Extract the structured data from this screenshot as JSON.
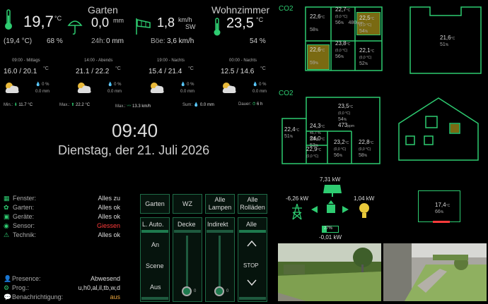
{
  "weather": {
    "garden": {
      "title": "Garten"
    },
    "wohnzimmer": {
      "title": "Wohnzimmer"
    },
    "outdoor_temp": "19,7",
    "outdoor_temp_unit": "°C",
    "outdoor_feels": "(19,4 °C)",
    "outdoor_humidity": "68 %",
    "rain_now": "0,0",
    "rain_unit": "mm",
    "rain_24h_label": "24h:",
    "rain_24h": "0 mm",
    "wind_speed": "1,8",
    "wind_unit": "km/h",
    "wind_dir": "SW",
    "gust_label": "Böe:",
    "gust": "3,6 km/h",
    "indoor_temp": "23,5",
    "indoor_temp_unit": "°C",
    "indoor_humidity": "54 %"
  },
  "forecast": [
    {
      "time": "09:00 - Mittags",
      "temp": "16.0 / 20.1",
      "unit": "°C",
      "rain_pct": "0 %",
      "rain_mm": "0.0 mm"
    },
    {
      "time": "14:00 - Abends",
      "temp": "21.1 / 22.2",
      "unit": "°C",
      "rain_pct": "0 %",
      "rain_mm": "0.0 mm"
    },
    {
      "time": "19:00 - Nachts",
      "temp": "15.4 / 21.4",
      "unit": "°C",
      "rain_pct": "0 %",
      "rain_mm": "0.0 mm"
    },
    {
      "time": "00:00 - Nachts",
      "temp": "12.5 / 14.6",
      "unit": "°C",
      "rain_pct": "0 %",
      "rain_mm": "0.0 mm"
    }
  ],
  "summary": {
    "min_label": "Min.:",
    "min": "11.7 °C",
    "max_label": "Max.:",
    "max": "22.2 °C",
    "wind_max_label": "Max.:",
    "wind_max": "13.3 km/h",
    "sum_label": "Sum:",
    "sum": "0.0 mm",
    "duration_label": "Dauer:",
    "duration": "6 h"
  },
  "clock": {
    "time": "09:40",
    "date": "Dienstag, der 21. Juli 2026"
  },
  "status": [
    {
      "label": "Fenster:",
      "value": "Alles zu",
      "color": "#dddddd"
    },
    {
      "label": "Garten:",
      "value": "Alles ok",
      "color": "#dddddd"
    },
    {
      "label": "Geräte:",
      "value": "Alles ok",
      "color": "#dddddd"
    },
    {
      "label": "Sensor:",
      "value": "Giessen",
      "color": "#ff3b3b"
    },
    {
      "label": "Technik:",
      "value": "Alles ok",
      "color": "#dddddd"
    }
  ],
  "presence": {
    "label": "Presence:",
    "value": "Abwesend",
    "prog_label": "Prog.:",
    "prog_value": "u,h0,al,il,tb,w,d",
    "notif_label": "Benachrichtigung:",
    "notif_value": "aus",
    "notif_color": "#e6a23c"
  },
  "controls": {
    "top_buttons": [
      "Garten",
      "WZ",
      "Alle Lampen",
      "Alle Rolläden"
    ],
    "col1_title": "L. Auto.",
    "col1_items": [
      "An",
      "Scene",
      "Aus"
    ],
    "col2_title": "Decke",
    "col2_value": "0",
    "col3_title": "Indirekt",
    "col3_value": "0",
    "col4_title": "Alle",
    "col4_stop": "STOP"
  },
  "floorplan": {
    "co2_label_top": "CO2",
    "co2_label_bottom": "CO2",
    "temp_unit": "°C",
    "pct": "%",
    "ppm": "ppm",
    "top_rooms": [
      {
        "t": "22,6",
        "h": "58",
        "extra": ""
      },
      {
        "t": "22,7",
        "h": "56",
        "extra": "(0,0 °C)",
        "ppm": "480"
      },
      {
        "t": "22,5",
        "h": "54",
        "extra": "(0,0 °C)"
      },
      {
        "t": "22,6",
        "h": "59",
        "extra": ""
      },
      {
        "t": "23,8",
        "h": "56",
        "extra": "(0,0 °C)"
      },
      {
        "t": "22,1",
        "h": "52",
        "extra": "(0,0 °C)"
      }
    ],
    "attic": {
      "t": "21,6",
      "h": "51"
    },
    "ground": [
      {
        "t": "23,5",
        "h": "54",
        "extra": "(0,0 °C)",
        "ppm": "473"
      },
      {
        "t": "22,4",
        "h": "51"
      },
      {
        "t": "24,3",
        "h": "53",
        "extra": "45,7 %"
      },
      {
        "t": "24,0",
        "h": "53"
      },
      {
        "t": "22,9",
        "h": "",
        "extra": "(0,0 °C)"
      },
      {
        "t": "23,2",
        "h": "56",
        "extra": "(0,0 °C)"
      },
      {
        "t": "22,8",
        "h": "58",
        "extra": "(0,0 °C)"
      }
    ]
  },
  "energy": {
    "solar": "7,31 kW",
    "grid": "-6,26 kW",
    "consumption": "1,04 kW",
    "battery_pct": "27%",
    "battery_power": "-0,01 kW"
  },
  "freezer": {
    "t": "17,4",
    "h": "66"
  },
  "colors": {
    "accent": "#2ecc71",
    "yellow_room": "#7a6a12",
    "alert": "#ff3b3b"
  }
}
